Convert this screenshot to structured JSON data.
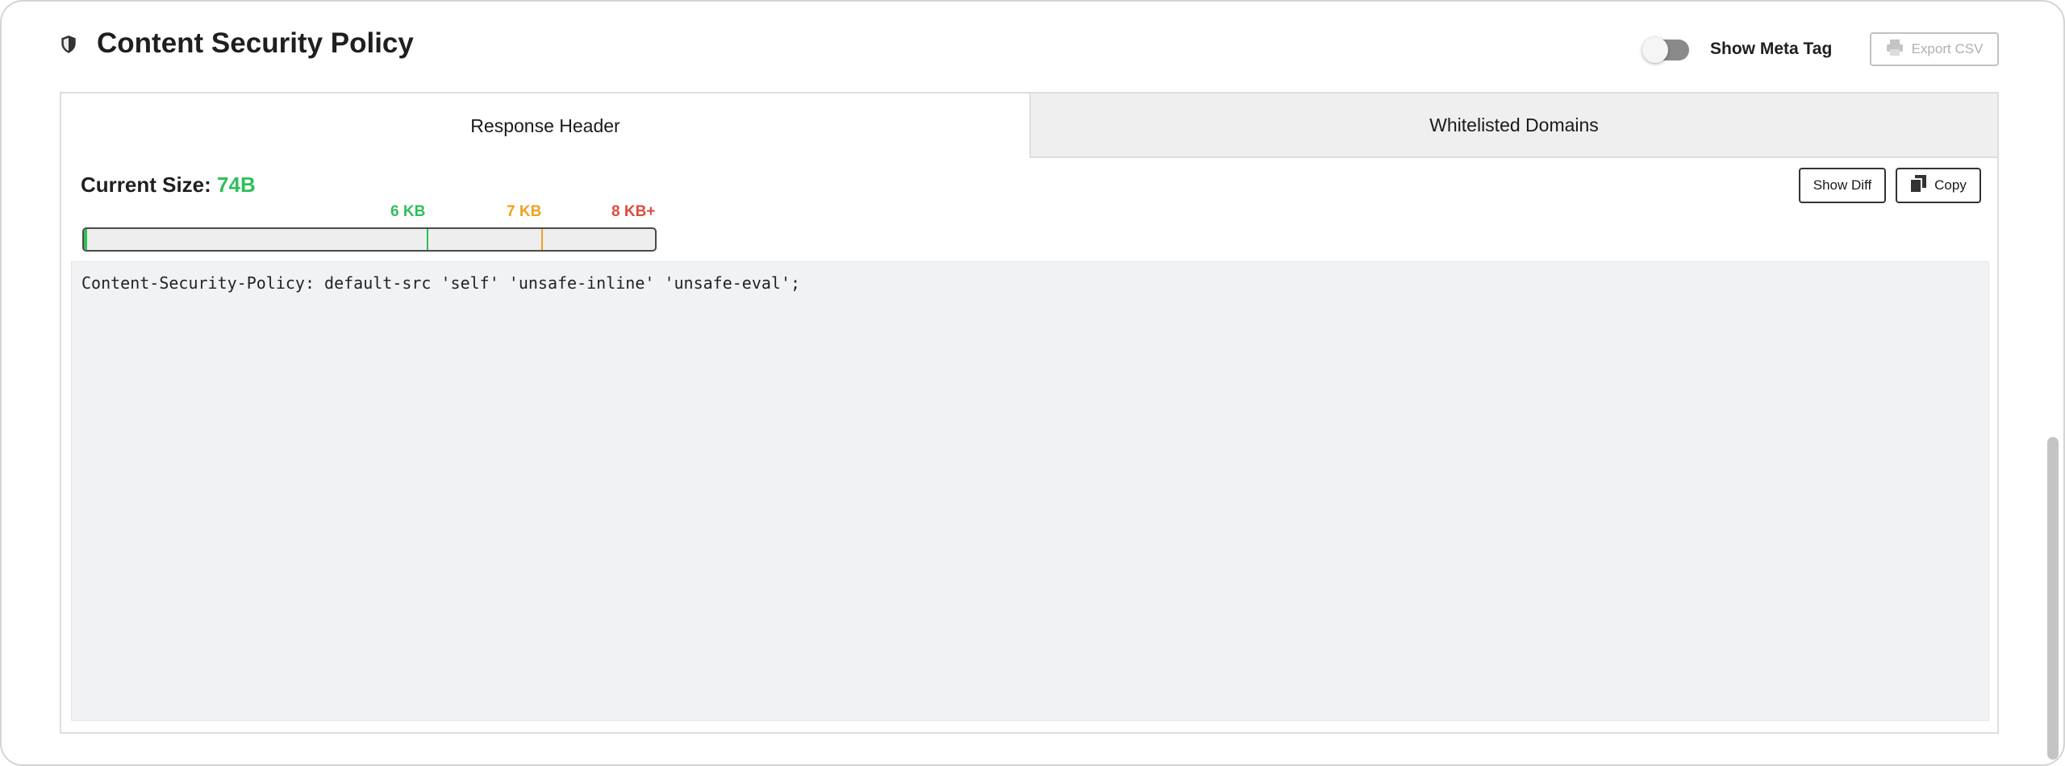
{
  "header": {
    "icon": "shield-icon",
    "title": "Content Security Policy",
    "toggle": {
      "label": "Show Meta Tag",
      "on": false
    },
    "export_button": {
      "label": "Export CSV",
      "icon": "printer-icon",
      "disabled": true
    }
  },
  "tabs": [
    {
      "label": "Response Header",
      "active": true
    },
    {
      "label": "Whitelisted Domains",
      "active": false
    }
  ],
  "size": {
    "label": "Current Size:",
    "value": "74B",
    "markers": [
      {
        "label": "6 KB",
        "color": "#2fbf5a"
      },
      {
        "label": "7 KB",
        "color": "#f0a020"
      },
      {
        "label": "8 KB+",
        "color": "#dc4b3c"
      }
    ],
    "bar_color": "#2fbf5a"
  },
  "actions": {
    "show_diff_label": "Show Diff",
    "copy_label": "Copy",
    "copy_icon": "copy-icon"
  },
  "policy_text": "Content-Security-Policy: default-src 'self' 'unsafe-inline' 'unsafe-eval';"
}
